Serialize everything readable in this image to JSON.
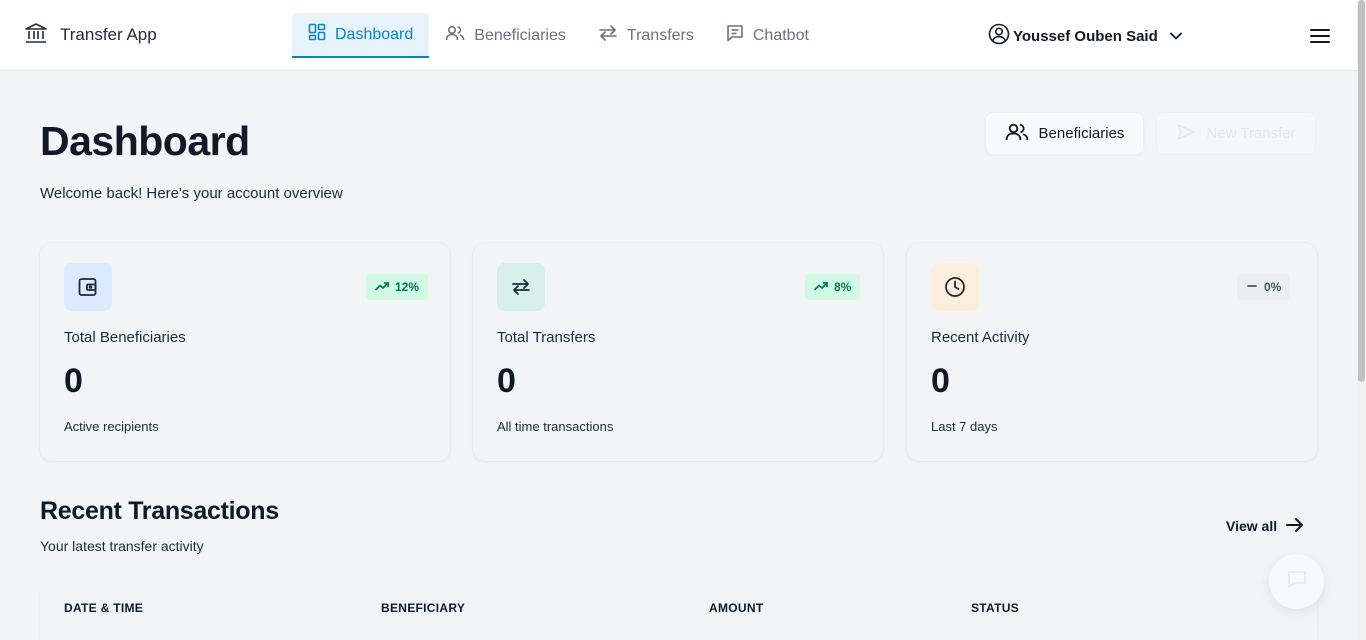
{
  "app": {
    "title": "Transfer App",
    "logo_icon": "bank-icon"
  },
  "nav": {
    "items": [
      {
        "label": "Dashboard",
        "icon": "dashboard-icon",
        "active": true
      },
      {
        "label": "Beneficiaries",
        "icon": "users-icon",
        "active": false
      },
      {
        "label": "Transfers",
        "icon": "transfer-arrows-icon",
        "active": false
      },
      {
        "label": "Chatbot",
        "icon": "chat-icon",
        "active": false
      }
    ],
    "user_name": "Youssef Ouben Said"
  },
  "header": {
    "title": "Dashboard",
    "subtitle": "Welcome back! Here's your account overview",
    "beneficiaries_button": "Beneficiaries",
    "new_transfer_button": "New Transfer"
  },
  "stats": [
    {
      "title": "Total Beneficiaries",
      "value": "0",
      "footer": "Active recipients",
      "badge": "12%",
      "trend": "up",
      "icon": "wallet-icon"
    },
    {
      "title": "Total Transfers",
      "value": "0",
      "footer": "All time transactions",
      "badge": "8%",
      "trend": "up",
      "icon": "transfer-arrows-icon"
    },
    {
      "title": "Recent Activity",
      "value": "0",
      "footer": "Last 7 days",
      "badge": "0%",
      "trend": "flat",
      "icon": "clock-icon"
    }
  ],
  "recent_transactions": {
    "title": "Recent Transactions",
    "subtitle": "Your latest transfer activity",
    "view_all": "View all",
    "columns": [
      "DATE & TIME",
      "BENEFICIARY",
      "AMOUNT",
      "STATUS"
    ]
  },
  "colors": {
    "accent": "#0b84c6",
    "accent_bg": "#e6f3fb",
    "badge_up_bg": "#d1fae5",
    "badge_up_text": "#047857",
    "badge_flat_bg": "#f3f4f6"
  }
}
